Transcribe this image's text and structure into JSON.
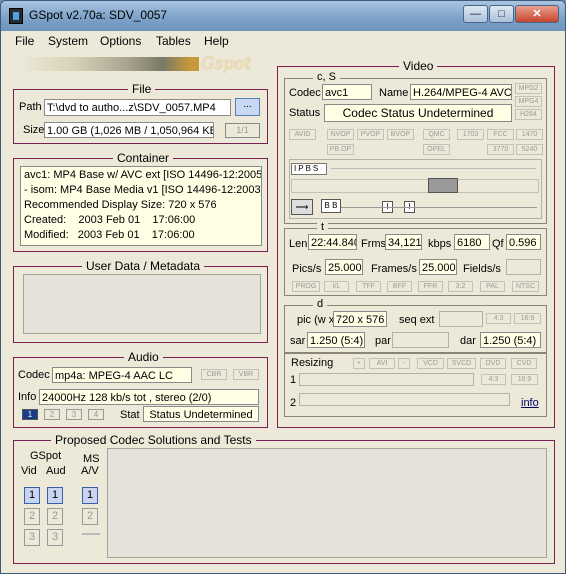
{
  "window": {
    "title": "GSpot v2.70a: SDV_0057"
  },
  "menu": [
    "File",
    "System",
    "Options",
    "Tables",
    "Help"
  ],
  "logo_text": "Gspot",
  "file": {
    "legend": "File",
    "path_label": "Path",
    "path_value": "T:\\dvd to autho...z\\SDV_0057.MP4",
    "browse_label": "...",
    "size_label": "Size",
    "size_value": "1.00 GB (1,026 MB / 1,050,964 KB",
    "page_indicator": "1/1"
  },
  "container": {
    "legend": "Container",
    "lines": [
      "avc1: MP4 Base w/ AVC ext [ISO 14496-12:2005",
      "- isom: MP4  Base Media v1 [ISO 14496-12:2003]",
      "Recommended Display Size: 720 x 576",
      "Created:    2003 Feb 01    17:06:00",
      "Modified:   2003 Feb 01    17:06:00"
    ]
  },
  "userdata": {
    "legend": "User Data / Metadata"
  },
  "audio": {
    "legend": "Audio",
    "codec_label": "Codec",
    "codec_value": "mp4a: MPEG-4 AAC LC",
    "cbr_label": "CBR",
    "vbr_label": "VBR",
    "info_label": "Info",
    "info_value": "24000Hz  128 kb/s tot , stereo (2/0)",
    "stream_buttons": [
      "1",
      "2",
      "3",
      "4"
    ],
    "stat_label": "Stat",
    "stat_value": "Status Undetermined"
  },
  "video": {
    "legend": "Video",
    "cs_legend": "c, S",
    "codec_label": "Codec",
    "codec_value": "avc1",
    "name_label": "Name",
    "name_value": "H.264/MPEG-4 AVC",
    "mpeg_badges": [
      "MPG2",
      "MPG4",
      "H264"
    ],
    "status_label": "Status",
    "status_value": "Codec Status Undetermined",
    "flag_row1": [
      "AVID",
      "NVOP",
      "PVOP",
      "BVOP",
      "QMC",
      "1703",
      "FCC",
      "1470"
    ],
    "flag_row2": [
      "PB OP",
      "OPEL",
      "3770",
      "5240"
    ],
    "frame_types": [
      "I",
      "P",
      "B",
      "S"
    ],
    "t_legend": "t",
    "len_label": "Len",
    "len_value": "22:44.840",
    "frms_label": "Frms",
    "frms_value": "34,121",
    "kbps_label": "kbps",
    "kbps_value": "6180",
    "qf_label": "Qf",
    "qf_value": "0.596",
    "pics_label": "Pics/s",
    "pics_value": "25.000",
    "frames_label": "Frames/s",
    "frames_value": "25.000",
    "fields_label": "Fields/s",
    "fields_value": "",
    "std_badges": [
      "PROG",
      "I/L",
      "TFF",
      "BFF",
      "FFR",
      "3:2",
      "PAL",
      "NTSC"
    ],
    "d_legend": "d",
    "pic_label": "pic (w x",
    "pic_value": "720 x 576",
    "seqext_label": "seq ext",
    "aspect_badges": [
      "4:3",
      "16:9"
    ],
    "sar_label": "sar",
    "sar_value": "1.250 (5:4)",
    "par_label": "par",
    "par_value": "",
    "dar_label": "dar",
    "dar_value": "1.250 (5:4)",
    "resizing_label": "Resizing",
    "resize_buttons": [
      "+",
      "AVI",
      "-",
      "VCD",
      "SVCD",
      "DVD",
      "CVD"
    ],
    "row1_label": "1",
    "row2_label": "2",
    "row_badges": [
      "4:3",
      "16:9"
    ],
    "info_link": "info"
  },
  "proposed": {
    "legend": "Proposed Codec Solutions and Tests",
    "gspot_label": "GSpot",
    "vid_label": "Vid",
    "aud_label": "Aud",
    "ms_label": "MS",
    "av_label": "A/V",
    "nums": [
      "1",
      "2",
      "3"
    ]
  }
}
